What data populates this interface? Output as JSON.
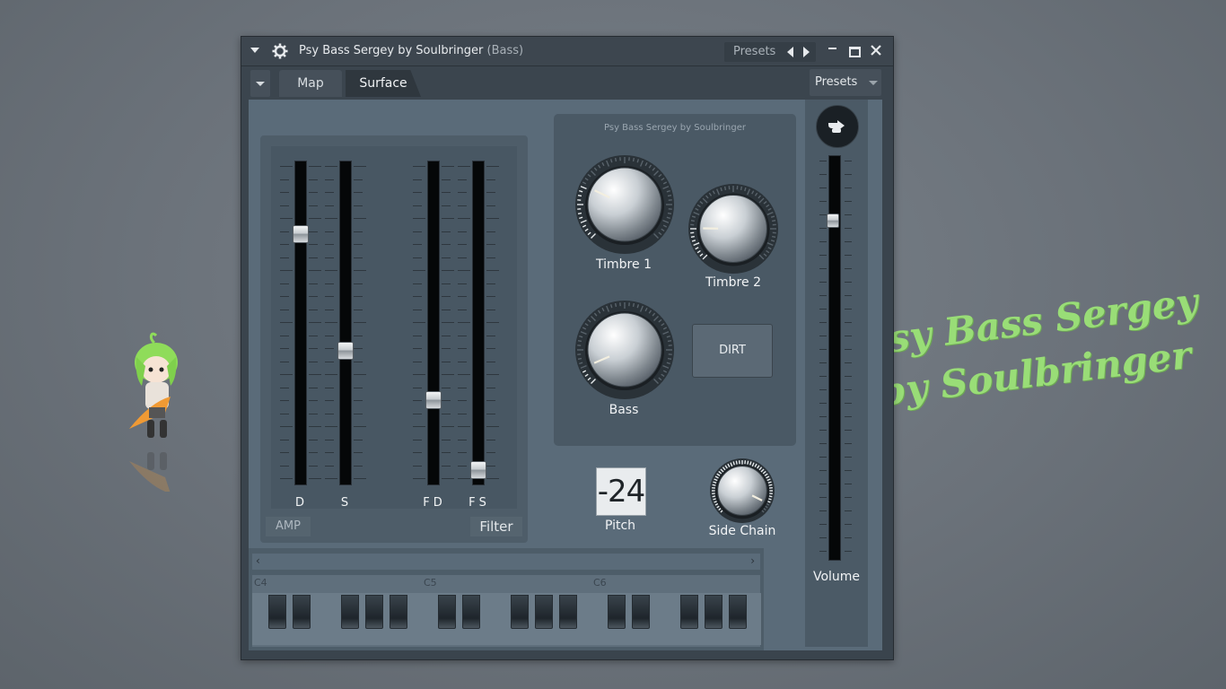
{
  "window": {
    "title": "Psy Bass Sergey by Soulbringer",
    "title_suffix": "(Bass)",
    "presets_label": "Presets"
  },
  "toolbar": {
    "tabs": [
      {
        "label": "Map",
        "active": false
      },
      {
        "label": "Surface",
        "active": true
      }
    ],
    "presets_dropdown": "Presets"
  },
  "amp_section": {
    "faders": [
      {
        "label": "D",
        "value": 0.21
      },
      {
        "label": "S",
        "value": 0.59
      },
      {
        "label": "F D",
        "value": 0.75
      },
      {
        "label": "F S",
        "value": 0.98
      }
    ],
    "amp_tag": "AMP",
    "filter_tag": "Filter"
  },
  "knob_panel": {
    "title": "Psy Bass Sergey by Soulbringer",
    "knobs": [
      {
        "label": "Timbre 1",
        "value": 0.26
      },
      {
        "label": "Timbre 2",
        "value": 0.17
      },
      {
        "label": "Bass",
        "value": 0.08
      }
    ],
    "dirt_button": "DIRT"
  },
  "pitch": {
    "value": "-24",
    "label": "Pitch"
  },
  "side_chain": {
    "label": "Side Chain",
    "value": 0.93
  },
  "volume": {
    "label": "Volume",
    "value": 0.85
  },
  "keyboard": {
    "octave_labels": [
      "C4",
      "C5",
      "C6"
    ],
    "scroll_left": "‹",
    "scroll_right": "›"
  },
  "desktop": {
    "brand_line1": "Psy Bass Sergey",
    "brand_line2": "by Soulbringer"
  },
  "colors": {
    "window_bg": "#3a444d",
    "surface_bg": "#5a6b79",
    "brand_green": "#99dd77"
  }
}
